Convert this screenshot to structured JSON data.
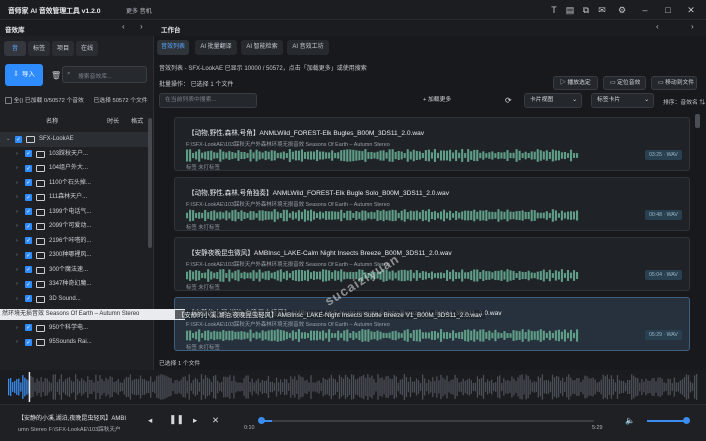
{
  "app": {
    "title": "音师家 AI 音效管理工具 v1.2.0",
    "menu": "更多 音机"
  },
  "titlebar_icons": [
    "text-icon",
    "note-icon",
    "copy-icon",
    "chat-icon",
    "gear-icon",
    "minimize-icon",
    "maximize-icon",
    "close-icon"
  ],
  "library": {
    "title": "音效库",
    "tabs": [
      "音",
      "标签",
      "项目",
      "在线"
    ],
    "import_label": "导入",
    "search_placeholder": "搜索音效库... ",
    "status_text": "全() 已加载 0/50572 个音效",
    "status_selected": "已选择 50572 个文件",
    "columns": {
      "name": "名称",
      "duration": "时长",
      "format": "格式"
    },
    "tree": [
      {
        "label": "SFX-LookAE",
        "root": true
      },
      {
        "label": "103踩秋天户..."
      },
      {
        "label": "104组户外大..."
      },
      {
        "label": "1100个石头掉..."
      },
      {
        "label": "111森林天户..."
      },
      {
        "label": "1399个电话气..."
      },
      {
        "label": "2099个可爱动..."
      },
      {
        "label": "2196个咔嗒的..."
      },
      {
        "label": "2300种哪裡风..."
      },
      {
        "label": "300个魔法速..."
      },
      {
        "label": "3347种奇幻魔..."
      },
      {
        "label": "3D Sound..."
      },
      {
        "label": "93.Doors 210..."
      },
      {
        "label": "950个科学电..."
      },
      {
        "label": "95Sounds Rai..."
      }
    ]
  },
  "workspace": {
    "title": "工作台",
    "tabs": [
      "音效列表",
      "AI 批量翻译",
      "AI 智能检索",
      "AI 音效工坊"
    ],
    "list_info": "音效列表 - SFX-LookAE  已显示 10000 / 50572，点击「加载更多」或使用搜索",
    "batch_info": "批量操作：  已选择 1 个文件",
    "buttons": {
      "play_selected": "播放选定",
      "locate": "定位音效",
      "move": "移动到文件"
    },
    "filter_placeholder": "在当前列表中搜索...",
    "load_more": "加载更多",
    "view_mode": "卡片视图",
    "card_mode": "标签卡片",
    "sort_label": "排序：音效名 ⇅",
    "selected_count": "已选择 1 个文件",
    "cards": [
      {
        "title": "【动物,野性,森林,号角】ANMLWild_FOREST-Elk Bugles_B00M_3DS11_2.0.wav",
        "path": "F:\\SFX-LookAE\\103踩秋天户外森林环境无损音效 Seasons Of Earth – Autumn Stereo",
        "duration": "03:25 · WAV",
        "tag": "标签  未打标签",
        "selected": false
      },
      {
        "title": "【动物,野性,森林,号角独奏】ANMLWild_FOREST-Elk Bugle Solo_B00M_3DS11_2.0.wav",
        "path": "F:\\SFX-LookAE\\103踩秋天户外森林环境无损音效 Seasons Of Earth – Autumn Stereo",
        "duration": "00:48 · WAV",
        "tag": "标签  未打标签",
        "selected": false
      },
      {
        "title": "【安静夜晚昆虫微风】AMBInsc_LAKE-Calm Night Insects Breeze_B00M_3DS11_2.0.wav",
        "path": "F:\\SFX-LookAE\\103踩秋天户外森林环境无损音效 Seasons Of Earth – Autumn Stereo",
        "duration": "05:04 · WAV",
        "tag": "标签  未打标签",
        "selected": false
      },
      {
        "title": "【安静的小溪,湖泊,夜晚昆虫轻风】AMBInsc_LAKE-Night Insects Subtle Breeze V1_B00M_3DS11_2.0.wav",
        "path": "F:\\SFX-LookAE\\103踩秋天户外森林环境无损音效 Seasons Of Earth – Autumn Stereo",
        "duration": "05:29 · WAV",
        "tag": "标签  未打标签",
        "selected": true
      }
    ]
  },
  "tooltip": "然环境无损音效 Seasons Of Earth – Autumn Stereo",
  "hover_path": "【安静的小溪,湖泊,夜晚昆虫轻风】AMBInsc_LAKE-Night Insects Subtle Breeze V1_B00M_3DS11_2.0.wav",
  "watermark": "sucaiziyuan",
  "player": {
    "title": "【安静的小溪,湖泊,夜晚昆虫轻风】AMBI",
    "path": "umn Stereo  F:\\SFX-LookAE\\103踩秋天户",
    "time_current": "0:10",
    "time_total": "5:29",
    "progress": 0.03,
    "volume": 0.85
  },
  "colors": {
    "accent": "#2f8cff",
    "wave": "#5f9d87",
    "player_wave": "#3c8df0",
    "background": "#17191c"
  }
}
